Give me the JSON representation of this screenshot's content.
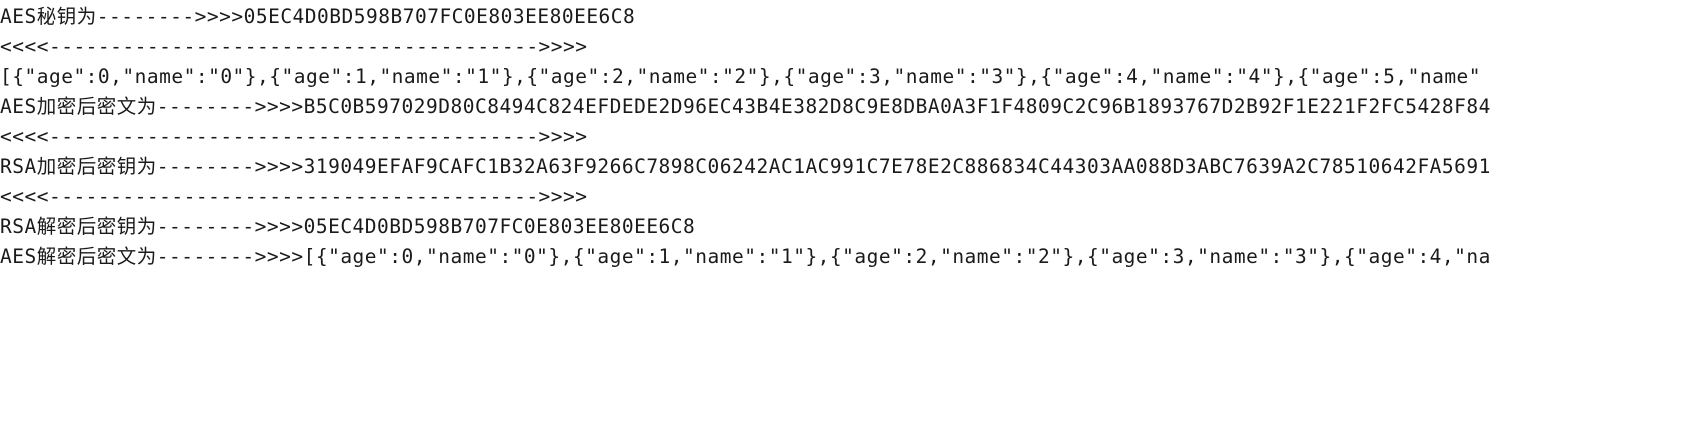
{
  "console": {
    "lines": [
      "AES秘钥为-------->>>>05EC4D0BD598B707FC0E803EE80EE6C8",
      "<<<<---------------------------------------->>>>",
      "[{\"age\":0,\"name\":\"0\"},{\"age\":1,\"name\":\"1\"},{\"age\":2,\"name\":\"2\"},{\"age\":3,\"name\":\"3\"},{\"age\":4,\"name\":\"4\"},{\"age\":5,\"name\"",
      "AES加密后密文为-------->>>>B5C0B597029D80C8494C824EFDEDE2D96EC43B4E382D8C9E8DBA0A3F1F4809C2C96B1893767D2B92F1E221F2FC5428F84",
      "<<<<---------------------------------------->>>>",
      "RSA加密后密钥为-------->>>>319049EFAF9CAFC1B32A63F9266C7898C06242AC1AC991C7E78E2C886834C44303AA088D3ABC7639A2C78510642FA5691",
      "<<<<---------------------------------------->>>>",
      "RSA解密后密钥为-------->>>>05EC4D0BD598B707FC0E803EE80EE6C8",
      "AES解密后密文为-------->>>>[{\"age\":0,\"name\":\"0\"},{\"age\":1,\"name\":\"1\"},{\"age\":2,\"name\":\"2\"},{\"age\":3,\"name\":\"3\"},{\"age\":4,\"na"
    ]
  }
}
